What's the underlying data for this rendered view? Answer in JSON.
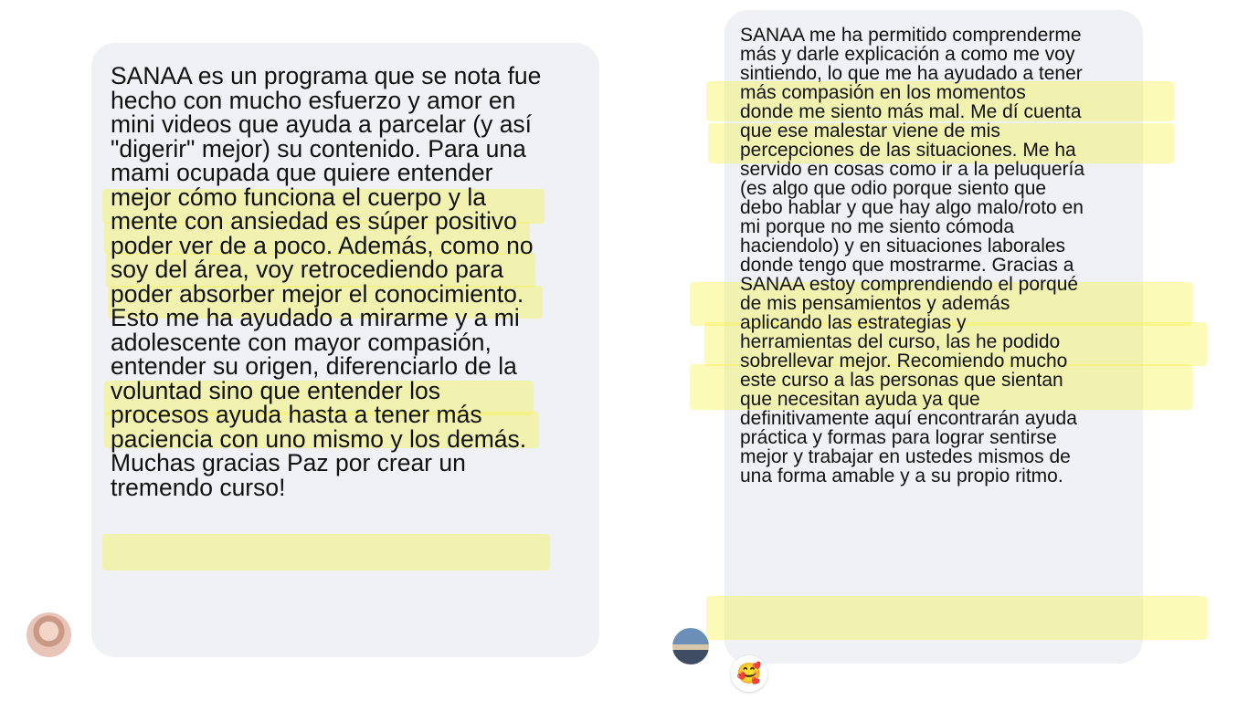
{
  "messages": [
    {
      "id": "left",
      "lines": [
        "SANAA es un programa que se nota fue",
        "hecho con mucho esfuerzo y amor en",
        "mini videos que ayuda a parcelar (y así",
        "\"digerir\" mejor) su contenido. Para una",
        "mami ocupada que quiere entender",
        "mejor cómo funciona el cuerpo y la",
        "mente con ansiedad es súper positivo",
        "poder ver de a poco. Además, como no",
        "soy del área, voy retrocediendo para",
        "poder absorber mejor el conocimiento.",
        "Esto me ha ayudado a mirarme y a mi",
        "adolescente con mayor compasión,",
        "entender su origen, diferenciarlo de la",
        "voluntad sino que entender los",
        "procesos ayuda hasta a tener más",
        "paciencia con uno mismo y los demás.",
        "Muchas gracias Paz por crear un",
        "tremendo curso!"
      ]
    },
    {
      "id": "right",
      "lines": [
        "SANAA me ha permitido comprenderme",
        "más y darle explicación a como me voy",
        "sintiendo, lo que me ha ayudado a tener",
        "más compasión en los momentos",
        "donde me siento más mal. Me dí cuenta",
        "que ese malestar viene de mis",
        "percepciones de las situaciones. Me ha",
        "servido en cosas como ir a la peluquería",
        "(es algo que odio porque siento que",
        "debo hablar y que hay algo malo/roto en",
        "mi porque no me siento cómoda",
        "haciendolo) y en situaciones laborales",
        "donde tengo que mostrarme. Gracias a",
        "SANAA estoy comprendiendo el porqué",
        "de mis pensamientos y además",
        "aplicando las estrategias y",
        "herramientas del curso, las he podido",
        "sobrellevar mejor. Recomiendo mucho",
        "este curso a las personas que sientan",
        "que necesitan ayuda ya que",
        "definitivamente aquí encontrarán ayuda",
        "práctica y formas para lograr sentirse",
        "mejor y trabajar en  ustedes mismos de",
        "una forma amable y a su propio ritmo."
      ],
      "reaction": "🥰"
    }
  ],
  "colors": {
    "bubble": "#f0f1f5",
    "highlight": "#f5f250",
    "text": "#111111"
  }
}
